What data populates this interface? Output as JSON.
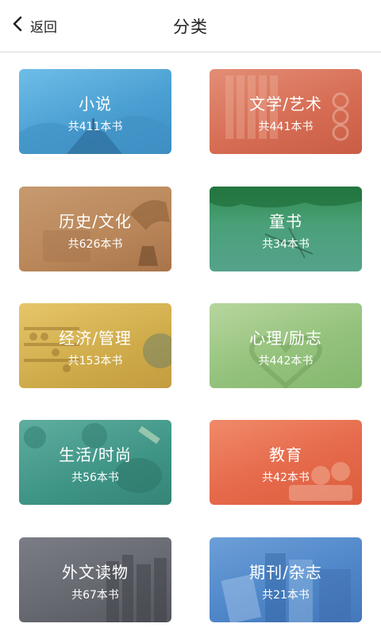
{
  "header": {
    "back_label": "返回",
    "title": "分类"
  },
  "categories": [
    {
      "name": "小说",
      "count": "共411本书"
    },
    {
      "name": "文学/艺术",
      "count": "共441本书"
    },
    {
      "name": "历史/文化",
      "count": "共626本书"
    },
    {
      "name": "童书",
      "count": "共34本书"
    },
    {
      "name": "经济/管理",
      "count": "共153本书"
    },
    {
      "name": "心理/励志",
      "count": "共442本书"
    },
    {
      "name": "生活/时尚",
      "count": "共56本书"
    },
    {
      "name": "教育",
      "count": "共42本书"
    },
    {
      "name": "外文读物",
      "count": "共67本书"
    },
    {
      "name": "期刊/杂志",
      "count": "共21本书"
    }
  ]
}
